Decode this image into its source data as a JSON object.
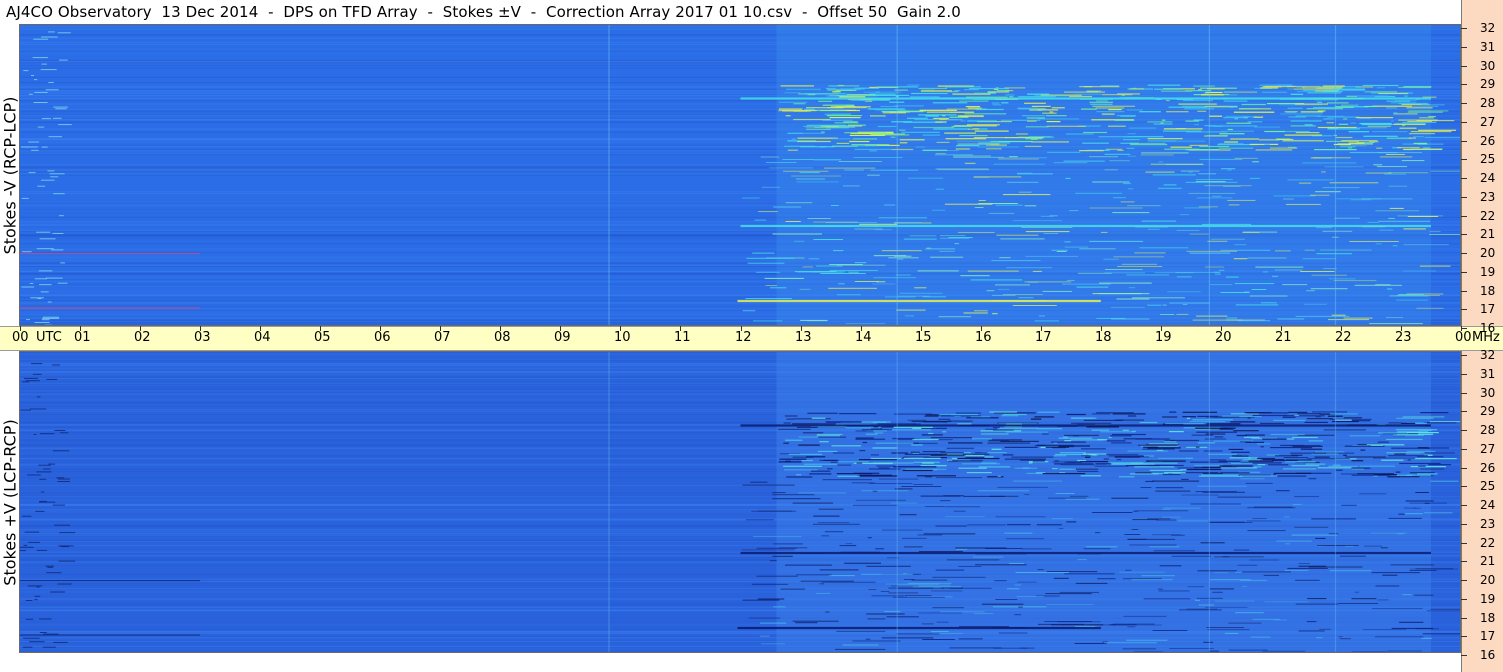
{
  "title": "AJ4CO Observatory  13 Dec 2014  -  DPS on TFD Array  -  Stokes ±V  -  Correction Array 2017 01 10.csv  -  Offset 50  Gain 2.0",
  "colors": {
    "background_blue": "#2b6de6",
    "time_band": "#ffffc4",
    "freq_axis": "#fcd9c1",
    "emission_cyan": "#45e0e8",
    "emission_yellow": "#e8f050",
    "absorption_dark": "#0a1a70"
  },
  "chart_data": [
    {
      "type": "heatmap",
      "ylabel": "Stokes -V (RCP-LCP)",
      "x_range_utc_hours": [
        0,
        24
      ],
      "y_range_mhz": [
        16,
        32
      ],
      "polarity": "positive",
      "activity_window_utc": [
        12,
        23.5
      ],
      "dense_band_mhz": [
        25.5,
        29
      ],
      "strong_lines_mhz": [
        17.5,
        21.5,
        28.3
      ]
    },
    {
      "type": "heatmap",
      "ylabel": "Stokes +V (LCP-RCP)",
      "x_range_utc_hours": [
        0,
        24
      ],
      "y_range_mhz": [
        16,
        32
      ],
      "polarity": "negative",
      "activity_window_utc": [
        12,
        23.5
      ],
      "dense_band_mhz": [
        25.5,
        29
      ],
      "strong_lines_mhz": [
        17.5,
        21.5,
        28.3
      ]
    }
  ],
  "time_axis": {
    "ticks": [
      "00",
      "01",
      "02",
      "03",
      "04",
      "05",
      "06",
      "07",
      "08",
      "09",
      "10",
      "11",
      "12",
      "13",
      "14",
      "15",
      "16",
      "17",
      "18",
      "19",
      "20",
      "21",
      "22",
      "23",
      "00"
    ],
    "utc_label": "UTC",
    "mhz_label": "MHz"
  },
  "freq_axis": {
    "ticks": [
      "32",
      "31",
      "30",
      "29",
      "28",
      "27",
      "26",
      "25",
      "24",
      "23",
      "22",
      "21",
      "20",
      "19",
      "18",
      "17",
      "16"
    ]
  }
}
